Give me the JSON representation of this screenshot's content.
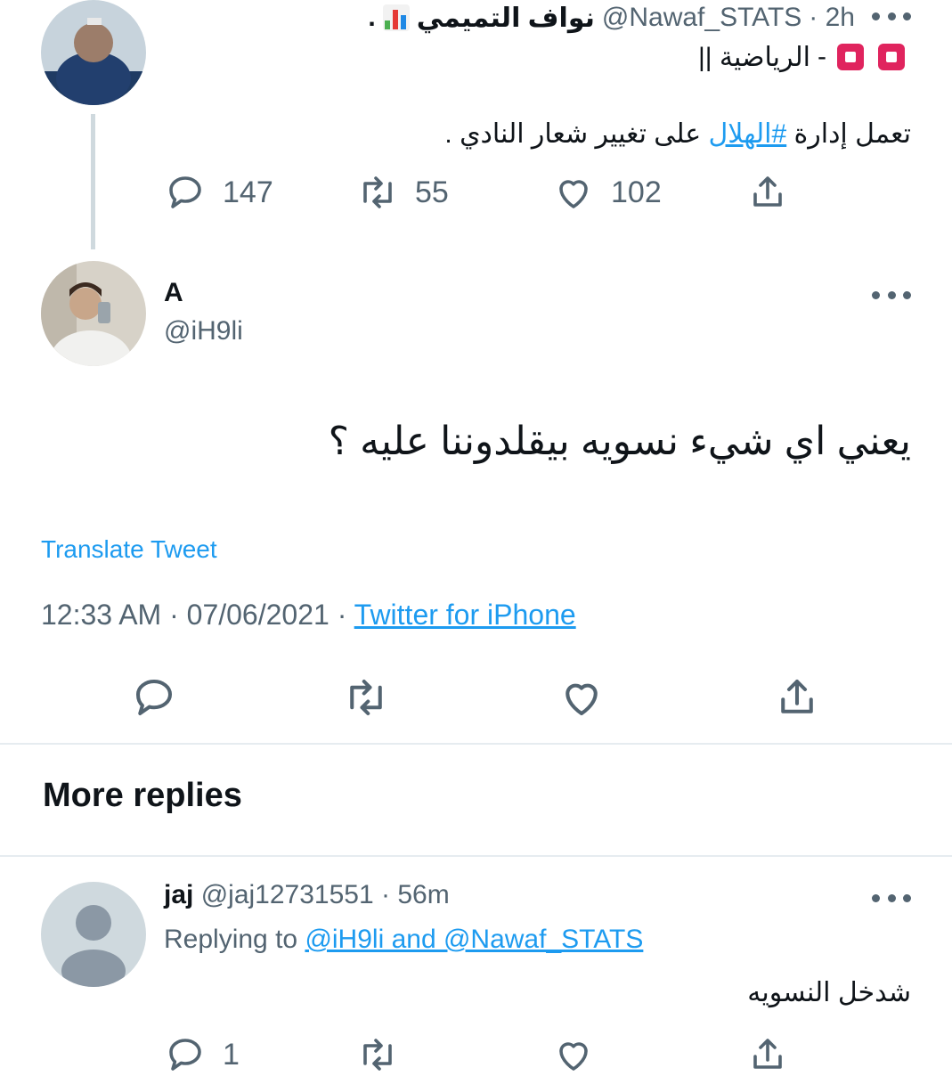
{
  "tweet1": {
    "display_name": "نواف التميمي",
    "display_name_dot": ".",
    "handle": "@Nawaf_STATS",
    "time": "· 2h",
    "bio_line": "الرياضية ||",
    "bio_dash": "-",
    "text_before": "تعمل إدارة",
    "hashtag": "#الهلال",
    "text_after": "على تغيير شعار النادي .",
    "stats": {
      "replies": "147",
      "retweets": "55",
      "likes": "102"
    }
  },
  "tweet2": {
    "display_name": "A",
    "handle": "@iH9li",
    "text": "يعني اي شيء نسويه بيقلدوننا عليه ؟",
    "translate_label": "Translate Tweet",
    "timestamp": "12:33 AM · 07/06/2021 ·",
    "source": "Twitter for iPhone"
  },
  "more_replies": {
    "heading": "More replies"
  },
  "reply1": {
    "display_name": "jaj",
    "handle": "@jaj12731551",
    "time": "· 56m",
    "replying_prefix": "Replying to",
    "replying_targets": "@iH9li and @Nawaf_STATS",
    "text": "شدخل النسويه",
    "stats": {
      "replies": "1"
    }
  },
  "icons": {
    "reply": "reply-icon",
    "retweet": "retweet-icon",
    "like": "heart-icon",
    "share": "share-icon",
    "more": "more-options-icon"
  },
  "colors": {
    "text": "#0f1419",
    "secondary": "#536471",
    "link": "#1d9bf0",
    "divider": "#e6ecf0"
  }
}
